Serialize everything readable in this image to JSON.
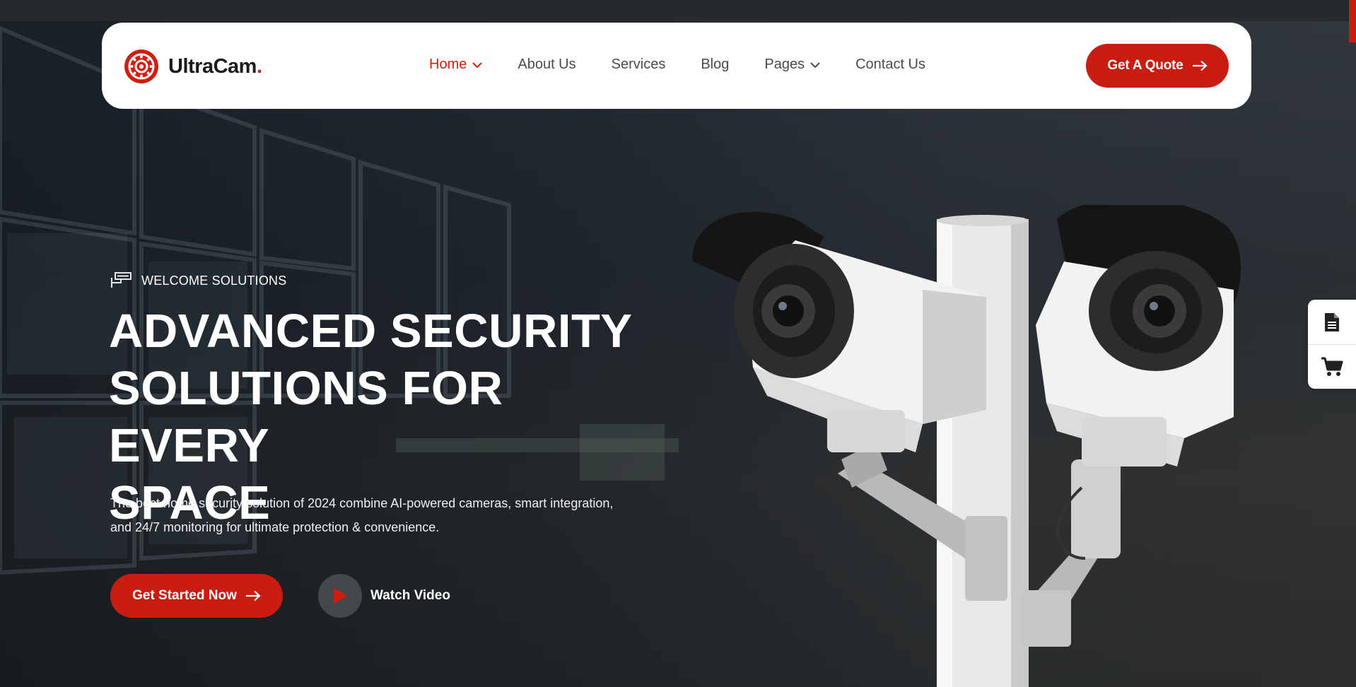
{
  "brand": {
    "name": "UltraCam",
    "dot": ".",
    "accent_color": "#d21c0f",
    "logo_icon": "camera-lens-icon"
  },
  "nav": {
    "items": [
      {
        "label": "Home",
        "active": true,
        "has_dropdown": true
      },
      {
        "label": "About Us",
        "active": false,
        "has_dropdown": false
      },
      {
        "label": "Services",
        "active": false,
        "has_dropdown": false
      },
      {
        "label": "Blog",
        "active": false,
        "has_dropdown": false
      },
      {
        "label": "Pages",
        "active": false,
        "has_dropdown": true
      },
      {
        "label": "Contact Us",
        "active": false,
        "has_dropdown": false
      }
    ],
    "cta_label": "Get A Quote"
  },
  "hero": {
    "eyebrow": "WELCOME SOLUTIONS",
    "eyebrow_icon": "cctv-camera-icon",
    "headline_lines": [
      "ADVANCED SECURITY",
      "SOLUTIONS FOR EVERY",
      "SPACE"
    ],
    "description_lines": [
      "The best home security solution of 2024 combine AI-powered cameras, smart integration,",
      "and 24/7 monitoring for ultimate protection & convenience."
    ],
    "primary_button": "Get Started Now",
    "video_button": "Watch Video"
  },
  "side_tools": [
    {
      "icon": "document-icon"
    },
    {
      "icon": "cart-icon"
    }
  ],
  "colors": {
    "primary_red": "#c81d10",
    "white": "#ffffff",
    "text_dark": "#1b1b1b",
    "nav_text": "#4b4b4b"
  }
}
